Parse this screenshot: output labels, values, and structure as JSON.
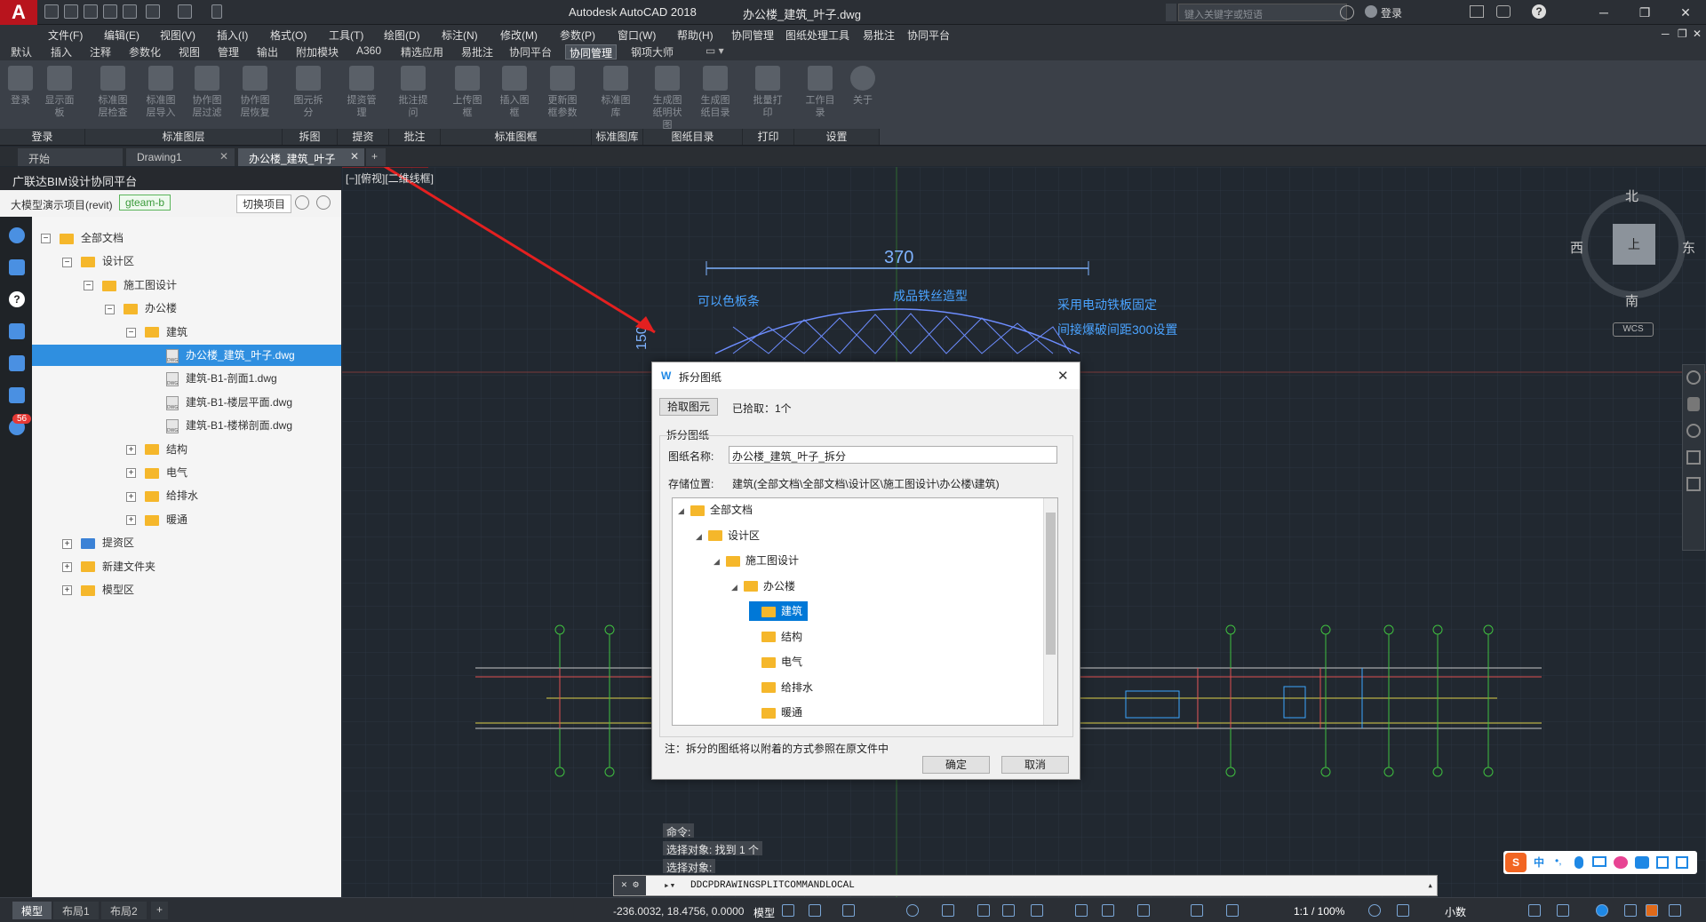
{
  "titlebar": {
    "logo": "A",
    "app": "Autodesk AutoCAD 2018",
    "file": "办公楼_建筑_叶子.dwg",
    "search_placeholder": "键入关键字或短语",
    "login": "登录"
  },
  "menu": [
    "文件(F)",
    "编辑(E)",
    "视图(V)",
    "插入(I)",
    "格式(O)",
    "工具(T)",
    "绘图(D)",
    "标注(N)",
    "修改(M)",
    "参数(P)",
    "窗口(W)",
    "帮助(H)",
    "协同管理",
    "图纸处理工具",
    "易批注",
    "协同平台"
  ],
  "ribbon_tabs": [
    "默认",
    "插入",
    "注释",
    "参数化",
    "视图",
    "管理",
    "输出",
    "附加模块",
    "A360",
    "精选应用",
    "易批注",
    "协同平台",
    "协同管理",
    "钢项大师"
  ],
  "ribbon_active": "协同管理",
  "ribbon_buttons": [
    "登录",
    "显示面板",
    "标准图层检查",
    "标准图层导入",
    "协作图层过滤",
    "协作图层恢复",
    "图元拆分",
    "提资管理",
    "批注提问",
    "上传图框",
    "插入图框",
    "更新图框参数",
    "标准图库",
    "生成图纸明状图",
    "生成图纸目录",
    "批量打印",
    "工作目录",
    "关于"
  ],
  "ribbon_panels": [
    "登录",
    "标准图层",
    "拆图",
    "提资",
    "批注",
    "标准图框",
    "标准图库",
    "图纸目录",
    "打印",
    "设置"
  ],
  "doc_tabs": [
    "开始",
    "Drawing1",
    "办公楼_建筑_叶子"
  ],
  "left_panel": {
    "title": "广联达BIM设计协同平台",
    "project": "大模型演示项目(revit)",
    "team": "gteam-b",
    "switch": "切换项目",
    "badge": "56",
    "tree": [
      {
        "label": "全部文档",
        "level": 0,
        "tog": "−",
        "type": "folder"
      },
      {
        "label": "设计区",
        "level": 1,
        "tog": "−",
        "type": "folder"
      },
      {
        "label": "施工图设计",
        "level": 2,
        "tog": "−",
        "type": "folder"
      },
      {
        "label": "办公楼",
        "level": 3,
        "tog": "−",
        "type": "folder"
      },
      {
        "label": "建筑",
        "level": 4,
        "tog": "−",
        "type": "folder"
      },
      {
        "label": "办公楼_建筑_叶子.dwg",
        "level": 5,
        "tog": "",
        "type": "dwg",
        "selected": true
      },
      {
        "label": "建筑-B1-剖面1.dwg",
        "level": 5,
        "tog": "",
        "type": "dwg"
      },
      {
        "label": "建筑-B1-楼层平面.dwg",
        "level": 5,
        "tog": "",
        "type": "dwg"
      },
      {
        "label": "建筑-B1-楼梯剖面.dwg",
        "level": 5,
        "tog": "",
        "type": "dwg"
      },
      {
        "label": "结构",
        "level": 4,
        "tog": "+",
        "type": "folder"
      },
      {
        "label": "电气",
        "level": 4,
        "tog": "+",
        "type": "folder"
      },
      {
        "label": "给排水",
        "level": 4,
        "tog": "+",
        "type": "folder"
      },
      {
        "label": "暖通",
        "level": 4,
        "tog": "+",
        "type": "folder"
      },
      {
        "label": "提资区",
        "level": 1,
        "tog": "+",
        "type": "share"
      },
      {
        "label": "新建文件夹",
        "level": 1,
        "tog": "+",
        "type": "folder"
      },
      {
        "label": "模型区",
        "level": 1,
        "tog": "+",
        "type": "folder"
      }
    ]
  },
  "canvas": {
    "viewport_label": "[−][俯视][二维线框]",
    "dim_370": "370",
    "dim_150": "150",
    "note1": "可以色板条",
    "note2": "成品铁丝造型",
    "note3": "采用电动铁板固定",
    "note4": "间接爆破间距300设置",
    "compass": {
      "n": "北",
      "s": "南",
      "e": "东",
      "w": "西",
      "top": "上"
    },
    "wcs": "WCS"
  },
  "dialog": {
    "title": "拆分图纸",
    "pick_btn": "拾取图元",
    "picked": "已拾取：1个",
    "group": "拆分图纸",
    "name_label": "图纸名称:",
    "name_value": "办公楼_建筑_叶子_拆分",
    "loc_label": "存储位置:",
    "loc_value": "建筑(全部文档\\全部文档\\设计区\\施工图设计\\办公楼\\建筑)",
    "tree": [
      {
        "label": "全部文档",
        "level": 0
      },
      {
        "label": "设计区",
        "level": 1
      },
      {
        "label": "施工图设计",
        "level": 2
      },
      {
        "label": "办公楼",
        "level": 3
      },
      {
        "label": "建筑",
        "level": 4,
        "selected": true
      },
      {
        "label": "结构",
        "level": 4
      },
      {
        "label": "电气",
        "level": 4
      },
      {
        "label": "给排水",
        "level": 4
      },
      {
        "label": "暖通",
        "level": 4
      }
    ],
    "note": "注：拆分的图纸将以附着的方式参照在原文件中",
    "ok": "确定",
    "cancel": "取消"
  },
  "command": {
    "hist1": "命令:",
    "hist2": "选择对象: 找到 1 个",
    "hist3": "选择对象:",
    "current": "DDCPDRAWINGSPLITCOMMANDLOCAL"
  },
  "status": {
    "layouts": [
      "模型",
      "布局1",
      "布局2"
    ],
    "coords": "-236.0032, 18.4756, 0.0000",
    "model": "模型",
    "scale": "1:1 / 100%",
    "units": "小数"
  }
}
